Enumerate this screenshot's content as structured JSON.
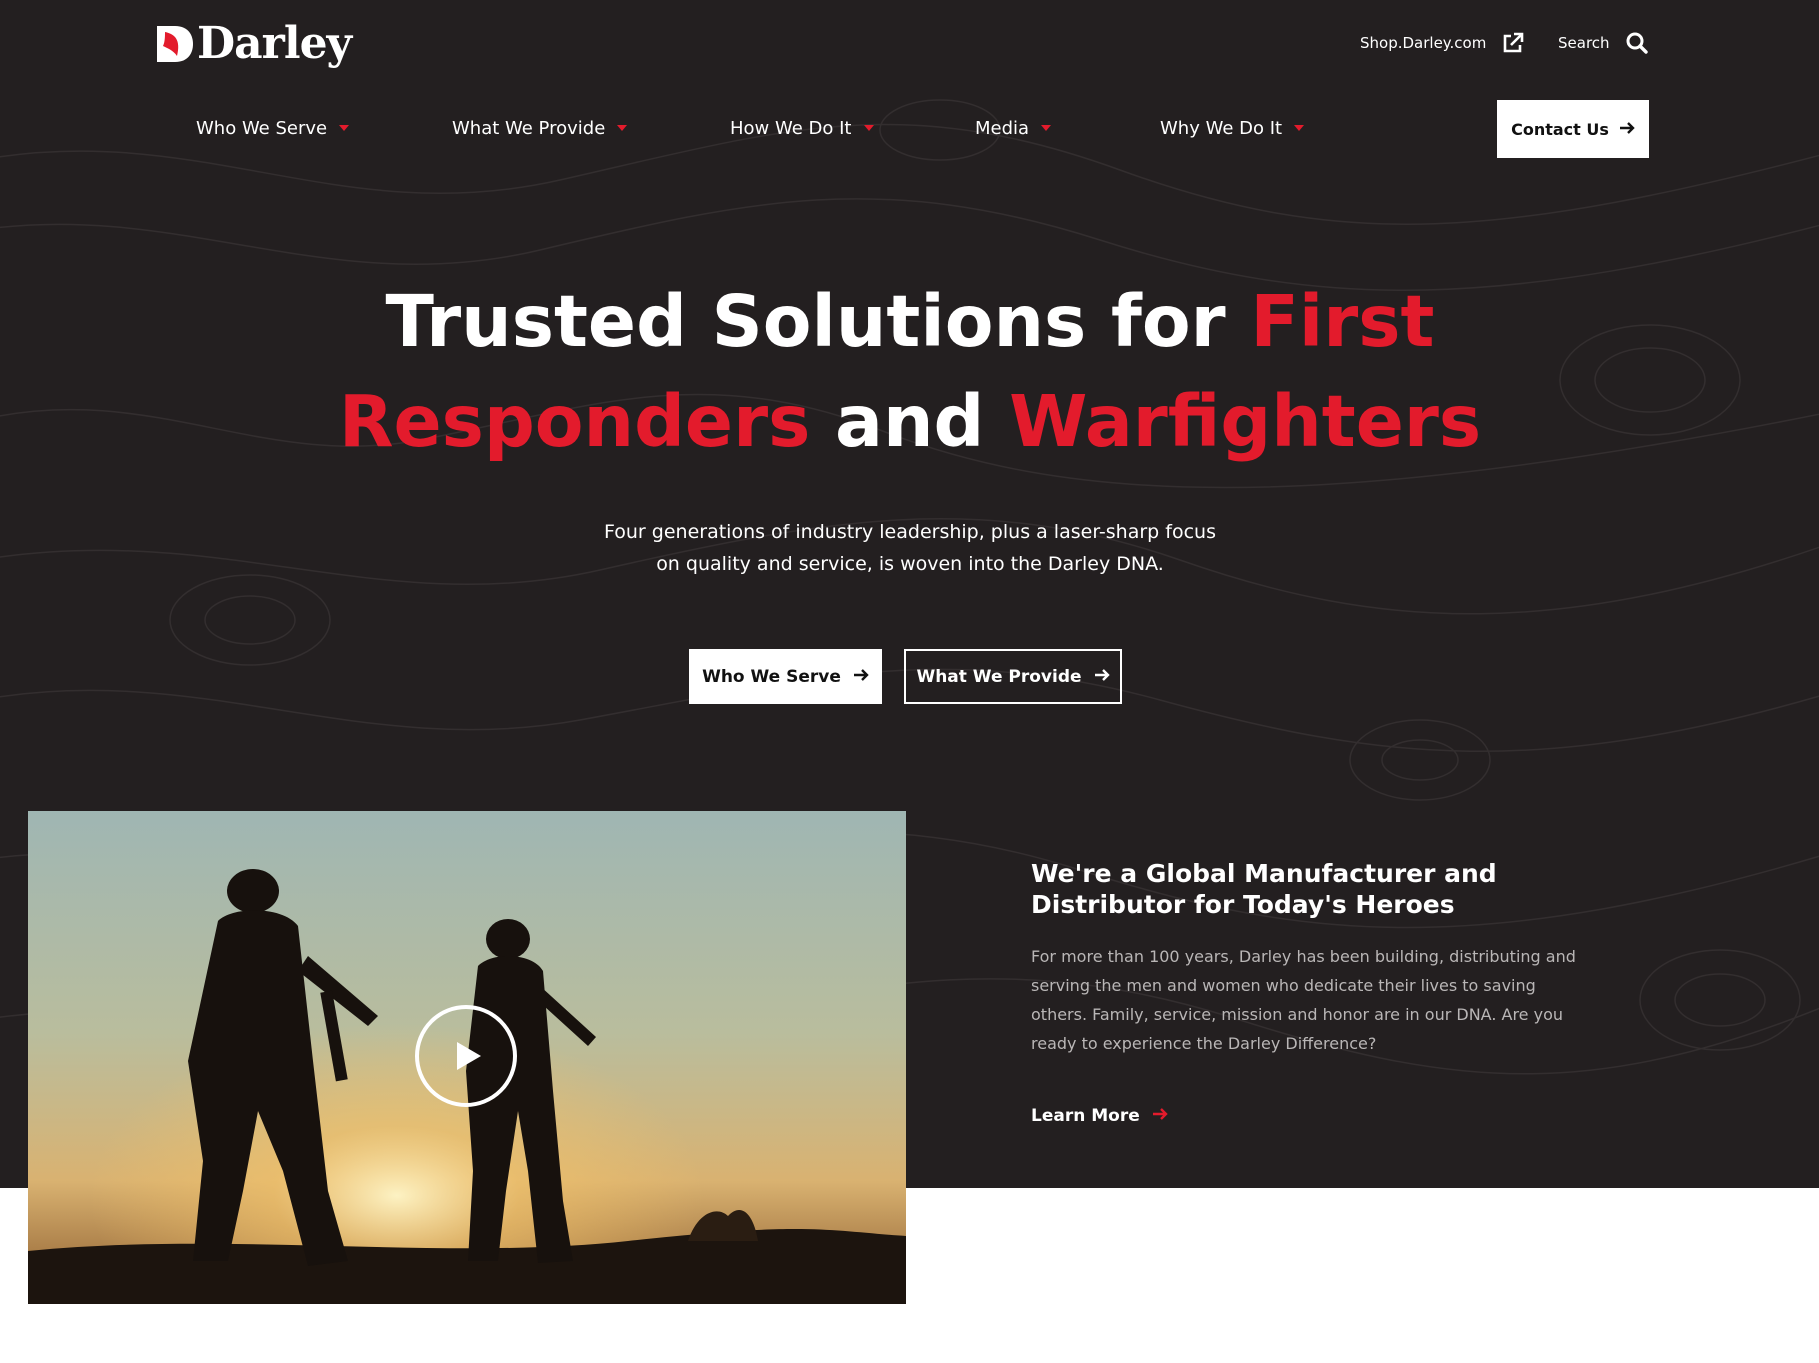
{
  "brand": {
    "name": "Darley",
    "accent_color": "#e31b2c",
    "background_color": "#231f20"
  },
  "utility": {
    "shop_label": "Shop.Darley.com",
    "shop_icon": "external-link-icon",
    "search_label": "Search",
    "search_icon": "search-icon"
  },
  "nav": {
    "items": [
      {
        "label": "Who We Serve",
        "icon": "caret-down-icon"
      },
      {
        "label": "What We Provide",
        "icon": "caret-down-icon"
      },
      {
        "label": "How We Do It",
        "icon": "caret-down-icon"
      },
      {
        "label": "Media",
        "icon": "caret-down-icon"
      },
      {
        "label": "Why We Do It",
        "icon": "caret-down-icon"
      }
    ],
    "contact_label": "Contact Us",
    "contact_icon": "arrow-right-icon"
  },
  "hero": {
    "headline": {
      "part1": "Trusted Solutions for ",
      "part2": "First",
      "part3": "Responders",
      "part4": " and ",
      "part5": "Warfighters"
    },
    "subtitle_line1": "Four generations of industry leadership, plus a laser-sharp focus",
    "subtitle_line2": "on quality and service, is woven into the Darley DNA.",
    "primary_cta": "Who We Serve",
    "secondary_cta": "What We Provide"
  },
  "about": {
    "video_icon": "play-icon",
    "title_line1": "We're a Global Manufacturer and",
    "title_line2": "Distributor for Today's Heroes",
    "body": "For more than 100 years, Darley has been building, distributing and serving the men and women who dedicate their lives to saving others. Family, service, mission and honor are in our DNA. Are you ready to experience the Darley Difference?",
    "learn_more": "Learn More"
  }
}
